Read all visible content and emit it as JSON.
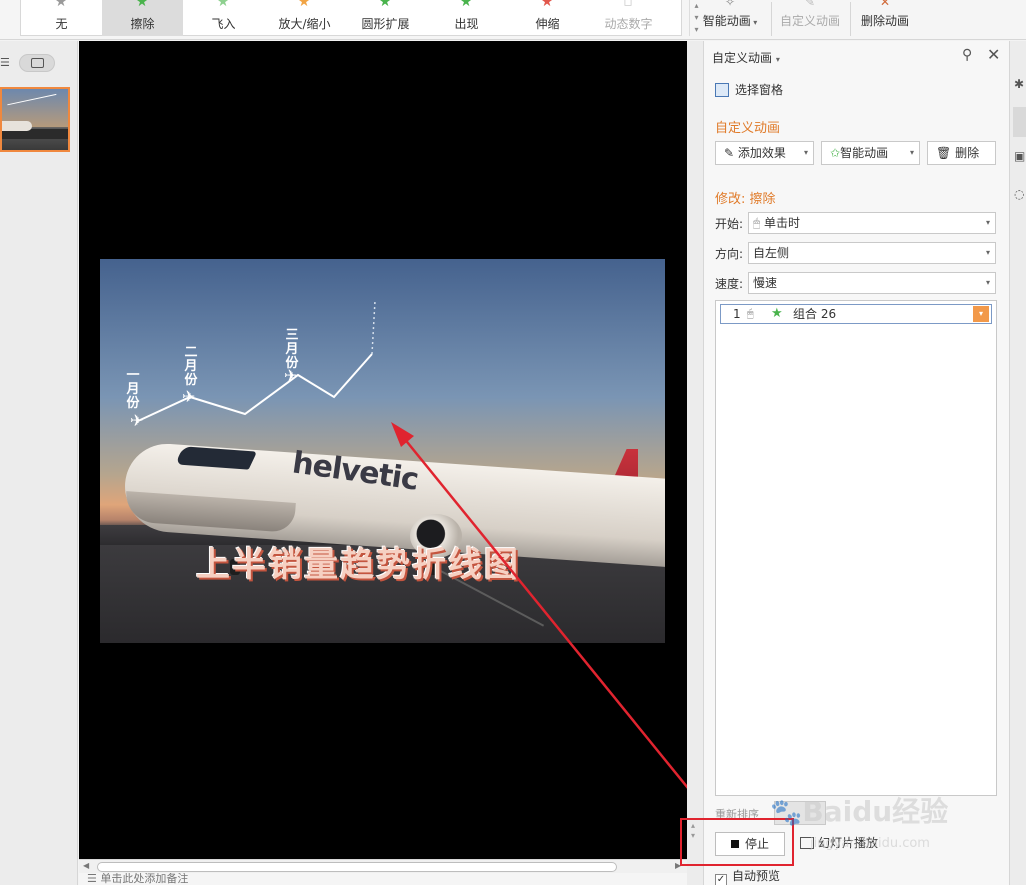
{
  "ribbon": {
    "gallery": [
      {
        "label": "无",
        "icon": "star-gray-icon",
        "selected": false
      },
      {
        "label": "擦除",
        "icon": "star-green-icon",
        "selected": true
      },
      {
        "label": "飞入",
        "icon": "star-green-icon",
        "selected": false
      },
      {
        "label": "放大/缩小",
        "icon": "star-orange-icon",
        "selected": false
      },
      {
        "label": "圆形扩展",
        "icon": "star-green-icon",
        "selected": false
      },
      {
        "label": "出现",
        "icon": "star-green-icon",
        "selected": false
      },
      {
        "label": "伸缩",
        "icon": "star-red-icon",
        "selected": false
      },
      {
        "label": "动态数字",
        "icon": "digits-icon",
        "selected": false,
        "disabled": true
      }
    ],
    "smart_animation": "智能动画",
    "custom_animation": "自定义动画",
    "delete_animation": "删除动画"
  },
  "slide": {
    "title": "上半销量趋势折线图",
    "brand": "helvetic",
    "months": [
      "一月份",
      "二月份",
      "三月份"
    ]
  },
  "task_pane": {
    "header": "自定义动画",
    "select_pane": "选择窗格",
    "section_title": "自定义动画",
    "add_effect": "添加效果",
    "smart_animation": "智能动画",
    "delete": "删除",
    "modify_title": "修改: 擦除",
    "start_label": "开始:",
    "start_value": "单击时",
    "direction_label": "方向:",
    "direction_value": "自左侧",
    "speed_label": "速度:",
    "speed_value": "慢速",
    "list_items": [
      {
        "index": "1",
        "name": "组合 26"
      }
    ],
    "reorder_label": "重新排序",
    "stop": "停止",
    "slideshow": "幻灯片播放",
    "auto_preview": "自动预览",
    "auto_preview_checked": true
  },
  "notes_placeholder": "单击此处添加备注",
  "watermark": {
    "brand": "Baidu经验",
    "url": "jingyan.baidu.com"
  },
  "colors": {
    "accent": "#e07b2a",
    "highlight": "#e0242f",
    "canvas": "#000000"
  }
}
